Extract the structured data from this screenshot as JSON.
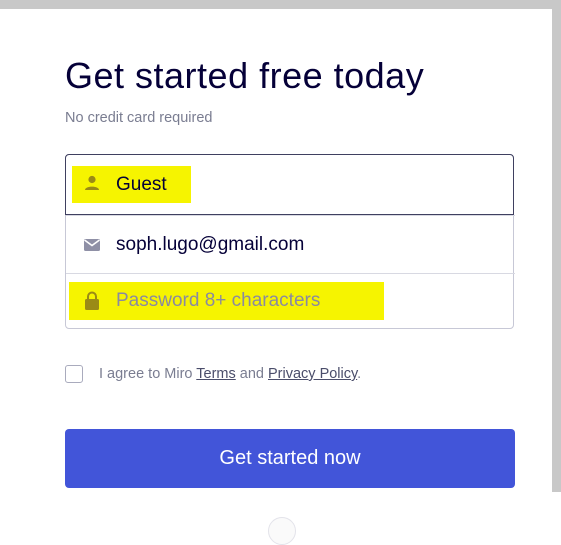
{
  "header": {
    "title": "Get started free today",
    "subtitle": "No credit card required"
  },
  "form": {
    "name_field": {
      "value": "Guest",
      "icon": "person-icon",
      "highlighted": true
    },
    "email_field": {
      "value": "soph.lugo@gmail.com",
      "icon": "envelope-icon"
    },
    "password_field": {
      "placeholder": "Password 8+ characters",
      "icon": "lock-icon",
      "highlighted": true
    }
  },
  "agreement": {
    "text_prefix": "I agree to Miro ",
    "terms_link": "Terms",
    "text_middle": " and ",
    "privacy_link": "Privacy Policy",
    "text_suffix": ".",
    "checked": false
  },
  "cta": {
    "label": "Get started now"
  },
  "colors": {
    "primary": "#4255d9",
    "highlight": "#f6f400",
    "title": "#050038"
  }
}
